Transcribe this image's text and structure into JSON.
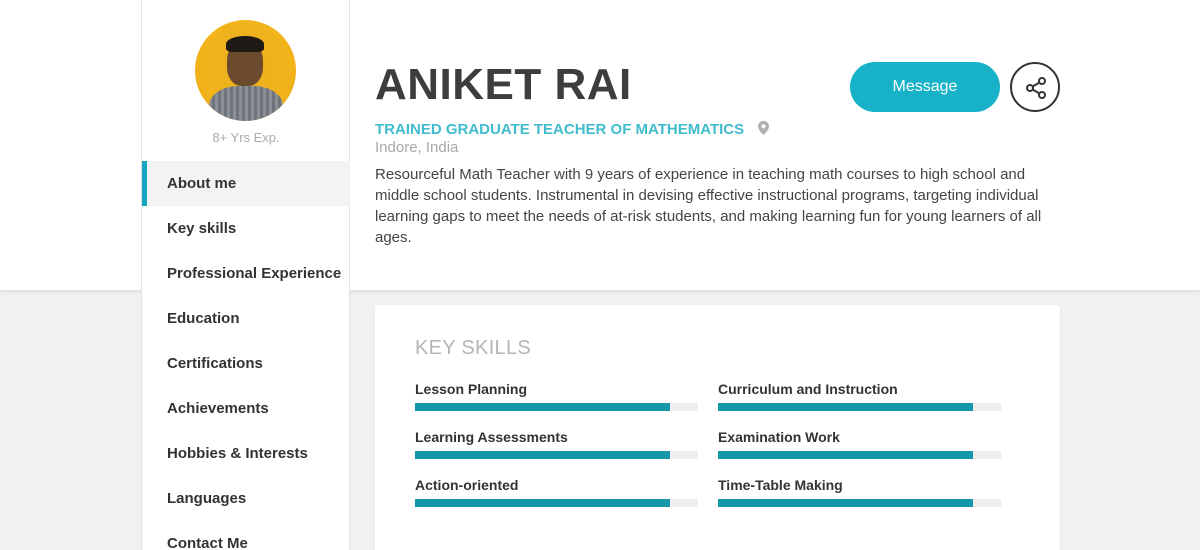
{
  "profile": {
    "name": "ANIKET RAI",
    "job_title": "TRAINED GRADUATE TEACHER OF MATHEMATICS",
    "location": "Indore, India",
    "experience": "8+ Yrs Exp.",
    "bio": "Resourceful Math Teacher with 9 years of experience in teaching math courses to high school and middle school students. Instrumental in devising effective instructional programs, targeting individual learning gaps to meet the needs of at-risk students, and making learning fun for young learners of all ages."
  },
  "actions": {
    "message_label": "Message",
    "share_icon": "share-icon"
  },
  "nav": {
    "active": "About me",
    "items": [
      {
        "label": "About me"
      },
      {
        "label": "Key skills"
      },
      {
        "label": "Professional Experience"
      },
      {
        "label": "Education"
      },
      {
        "label": "Certifications"
      },
      {
        "label": "Achievements"
      },
      {
        "label": "Hobbies & Interests"
      },
      {
        "label": "Languages"
      },
      {
        "label": "Contact Me"
      }
    ]
  },
  "skills_section": {
    "heading": "KEY SKILLS",
    "skills": [
      {
        "label": "Lesson Planning",
        "level": 0.9
      },
      {
        "label": "Curriculum and Instruction",
        "level": 0.9
      },
      {
        "label": "Learning Assessments",
        "level": 0.9
      },
      {
        "label": "Examination Work",
        "level": 0.9
      },
      {
        "label": "Action-oriented",
        "level": 0.9
      },
      {
        "label": "Time-Table Making",
        "level": 0.9
      }
    ]
  },
  "colors": {
    "accent": "#17b2c8",
    "skill_bar": "#1596a9",
    "job_title": "#41bccc",
    "avatar_bg": "#f2b31b"
  }
}
